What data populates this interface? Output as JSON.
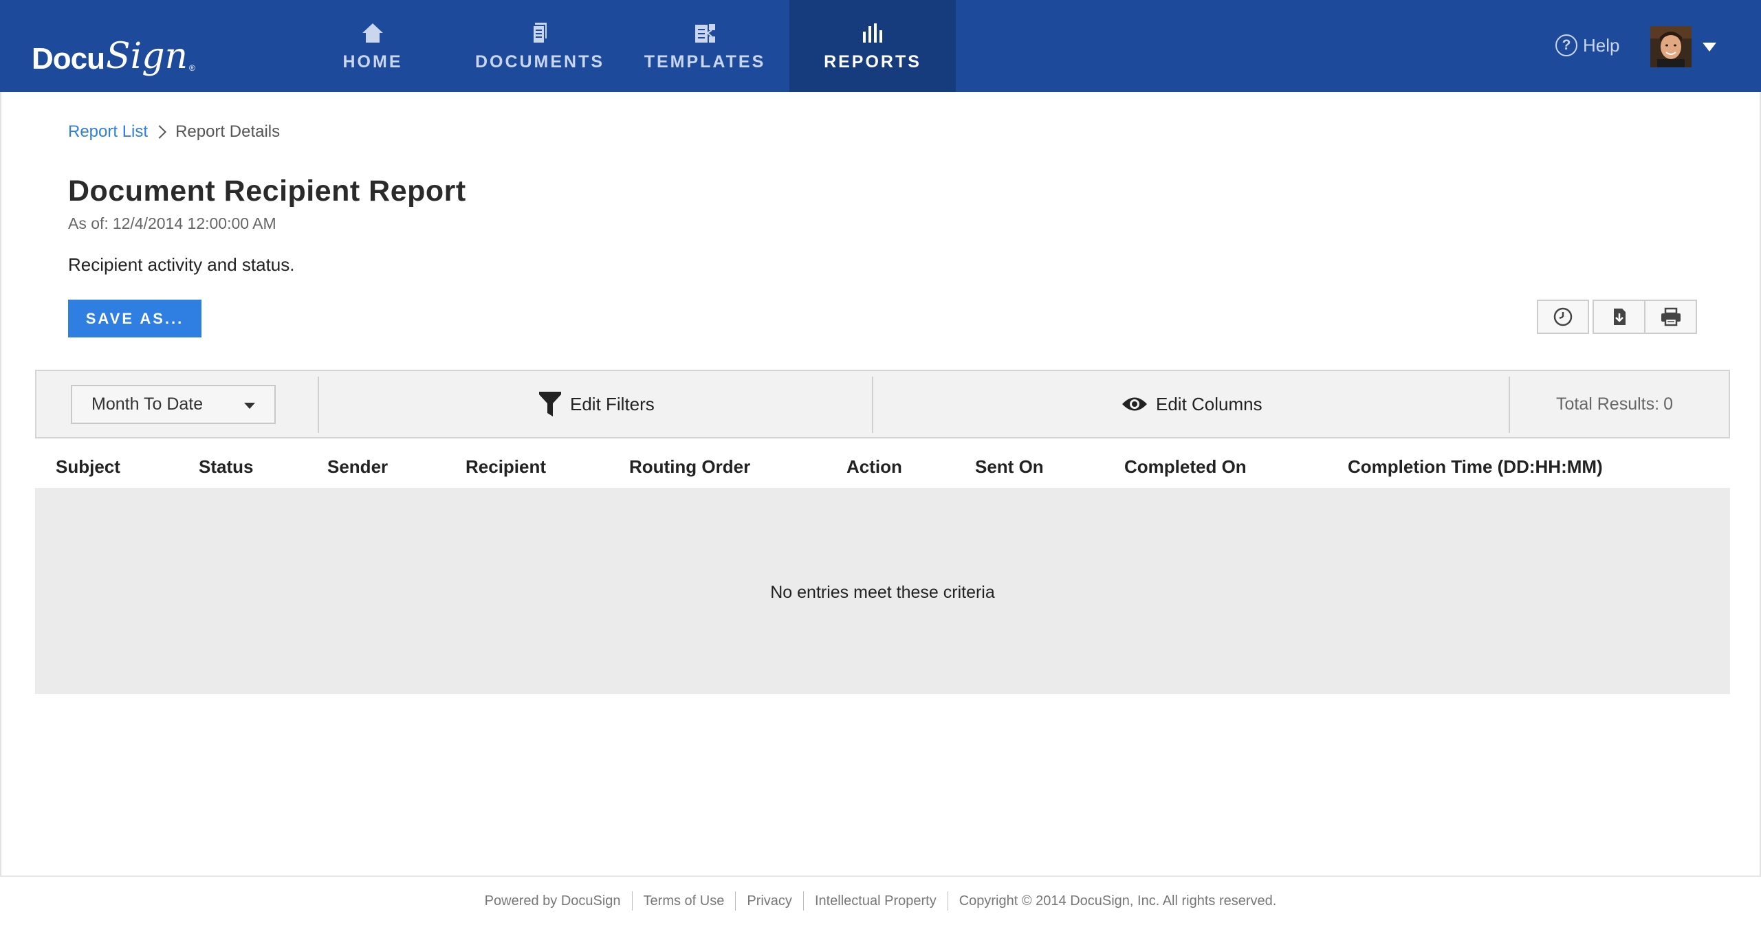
{
  "brand": {
    "logo_part1": "Docu",
    "logo_part2": "Sign",
    "logo_reg": "®"
  },
  "nav": {
    "home": {
      "label": "HOME",
      "icon": "home-icon"
    },
    "documents": {
      "label": "DOCUMENTS",
      "icon": "documents-icon"
    },
    "templates": {
      "label": "TEMPLATES",
      "icon": "templates-icon"
    },
    "reports": {
      "label": "REPORTS",
      "icon": "reports-icon",
      "active": true
    }
  },
  "header": {
    "help_label": "Help",
    "help_icon_text": "?"
  },
  "breadcrumb": {
    "link": "Report List",
    "current": "Report Details"
  },
  "report": {
    "title": "Document Recipient Report",
    "as_of_label": "As of:",
    "as_of_value": "12/4/2014 12:00:00 AM",
    "description": "Recipient activity and status."
  },
  "actions": {
    "save_label": "SAVE AS...",
    "icons": [
      "clock-icon",
      "download-icon",
      "print-icon"
    ]
  },
  "filters": {
    "period": "Month To Date",
    "edit_filters_label": "Edit Filters",
    "edit_columns_label": "Edit Columns",
    "total_results_label": "Total Results:",
    "total_results_value": "0"
  },
  "table": {
    "columns": [
      "Subject",
      "Status",
      "Sender",
      "Recipient",
      "Routing Order",
      "Action",
      "Sent On",
      "Completed On",
      "Completion Time (DD:HH:MM)"
    ],
    "empty_message": "No entries meet these criteria"
  },
  "footer": {
    "links": [
      "Powered by DocuSign",
      "Terms of Use",
      "Privacy",
      "Intellectual Property"
    ],
    "copyright": "Copyright © 2014 DocuSign, Inc. All rights reserved."
  },
  "colors": {
    "topbar": "#1d4a9b",
    "nav_active": "#173c7e",
    "primary_button": "#2f7fe3",
    "link": "#2f7fd9"
  }
}
